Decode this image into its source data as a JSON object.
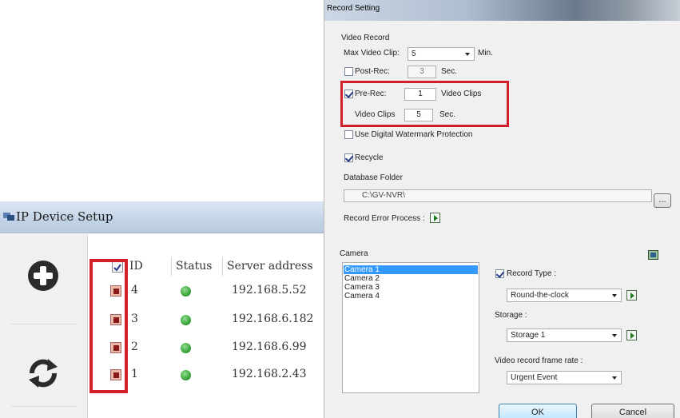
{
  "ip_device_setup": {
    "title": "IP Device Setup",
    "columns": [
      "ID",
      "Status",
      "Server address"
    ],
    "rows": [
      {
        "id": "4",
        "status": "online",
        "address": "192.168.5.52"
      },
      {
        "id": "3",
        "status": "online",
        "address": "192.168.6.182"
      },
      {
        "id": "2",
        "status": "online",
        "address": "192.168.6.99"
      },
      {
        "id": "1",
        "status": "online",
        "address": "192.168.2.43"
      }
    ],
    "left_buttons": [
      "add-icon",
      "refresh-icon"
    ],
    "status_color": "#2e9b2e",
    "highlight_color": "#d1202a"
  },
  "record_setting": {
    "title": "Record Setting",
    "video_record_label": "Video Record",
    "max_clip_label": "Max Video Clip:",
    "max_clip_value": "5",
    "max_clip_unit": "Min.",
    "post_rec_label": "Post-Rec:",
    "post_rec_value": "3",
    "post_rec_unit": "Sec.",
    "pre_rec_label": "Pre-Rec:",
    "pre_rec_value": "1",
    "pre_rec_unit": "Video Clips",
    "video_clips_label": "Video Clips",
    "video_clips_value": "5",
    "video_clips_unit": "Sec.",
    "watermark_label": "Use Digital Watermark Protection",
    "recycle_label": "Recycle",
    "db_folder_label": "Database Folder",
    "db_folder_value": "C:\\GV-NVR\\",
    "browse_label": "...",
    "error_process_label": "Record Error Process :",
    "camera_label": "Camera",
    "cameras": [
      "Camera 1",
      "Camera 2",
      "Camera 3",
      "Camera 4"
    ],
    "record_type_label": "Record Type :",
    "record_type_value": "Round-the-clock",
    "storage_label": "Storage :",
    "storage_value": "Storage 1",
    "frame_rate_label": "Video record frame rate :",
    "frame_rate_value": "Urgent Event",
    "ok_label": "OK",
    "cancel_label": "Cancel",
    "highlight_color": "#d1202a"
  }
}
